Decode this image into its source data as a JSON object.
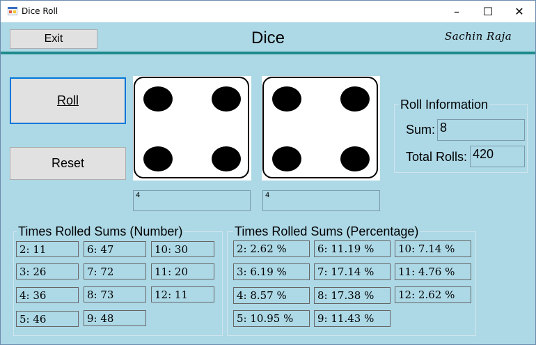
{
  "window": {
    "title": "Dice Roll",
    "controls": {
      "minimize": "–",
      "maximize": "☐",
      "close": "✕"
    }
  },
  "toolbar": {
    "exit_label": "Exit",
    "heading": "Dice",
    "author": "Sachin Raja"
  },
  "buttons": {
    "roll_label": "Roll",
    "reset_label": "Reset"
  },
  "dice": [
    {
      "value": "4",
      "face": 4
    },
    {
      "value": "4",
      "face": 4
    }
  ],
  "roll_info": {
    "title": "Roll Information",
    "sum_label": "Sum:",
    "sum_value": "8",
    "total_label": "Total Rolls:",
    "total_value": "420"
  },
  "sums_number": {
    "title": "Times Rolled Sums (Number)",
    "cells": [
      "2: 11",
      "6: 47",
      "10: 30",
      "3: 26",
      "7: 72",
      "11: 20",
      "4: 36",
      "8: 73",
      "12: 11",
      "5: 46",
      "9: 48"
    ]
  },
  "sums_percentage": {
    "title": "Times Rolled Sums (Percentage)",
    "cells": [
      "2: 2.62 %",
      "6: 11.19 %",
      "10: 7.14 %",
      "3: 6.19 %",
      "7: 17.14 %",
      "11: 4.76 %",
      "4: 8.57 %",
      "8: 17.38 %",
      "12: 2.62 %",
      "5: 10.95 %",
      "9: 11.43 %"
    ]
  }
}
